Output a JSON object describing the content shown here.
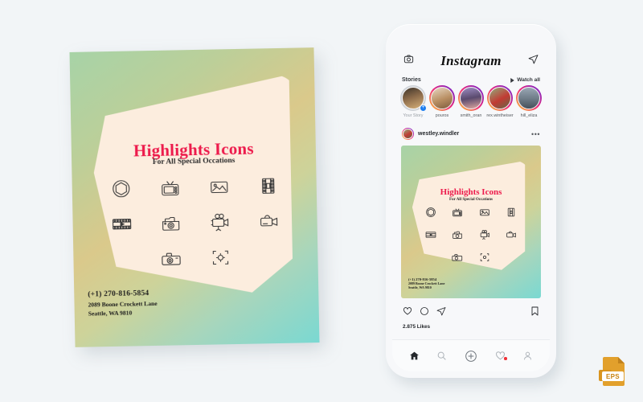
{
  "canvas": {
    "background": "#f2f5f7"
  },
  "poster": {
    "title": "Highlights Icons",
    "subtitle": "For All Special Occations",
    "title_color": "#ed1b4c",
    "cream_color": "#fcedde",
    "gradient": {
      "from": "#a7d3a7",
      "mid": "#dac98b",
      "to": "#7ad8d2"
    },
    "contact": {
      "phone": "(+1) 270-816-5854",
      "address_line1": "2089 Boone Crockett Lane",
      "address_line2": "Seattle, WA 9810"
    },
    "icons": [
      {
        "name": "aperture-icon"
      },
      {
        "name": "retro-tv-icon"
      },
      {
        "name": "photo-landscape-icon"
      },
      {
        "name": "film-strip-vertical-icon"
      },
      {
        "name": "film-strip-play-icon"
      },
      {
        "name": "vintage-camera-icon"
      },
      {
        "name": "movie-camera-icon"
      },
      {
        "name": "video-camera-icon"
      },
      {
        "name": "photo-camera-icon"
      },
      {
        "name": "focus-frame-icon"
      }
    ]
  },
  "phone": {
    "header": {
      "camera_icon": "camera-icon",
      "logo": "Instagram",
      "send_icon": "paper-plane-icon"
    },
    "stories": {
      "label": "Stories",
      "watch_all": "Watch all",
      "items": [
        {
          "name": "Your Story",
          "own": true,
          "seen": true
        },
        {
          "name": "pouros",
          "own": false,
          "seen": false
        },
        {
          "name": "smith_oran",
          "own": false,
          "seen": false
        },
        {
          "name": "rex.wintheiser",
          "own": false,
          "seen": false
        },
        {
          "name": "hill_eliza",
          "own": false,
          "seen": false
        }
      ]
    },
    "post": {
      "username": "westley.windler",
      "more_icon": "more-options-icon",
      "actions": {
        "like": "heart-icon",
        "comment": "comment-icon",
        "share": "paper-plane-icon",
        "save": "bookmark-icon"
      },
      "likes": "2.875 Likes"
    },
    "tabbar": [
      {
        "name": "tab-home",
        "icon": "home-icon",
        "active": true,
        "badge": false
      },
      {
        "name": "tab-search",
        "icon": "search-icon",
        "active": false,
        "badge": false
      },
      {
        "name": "tab-create",
        "icon": "plus-circle-icon",
        "active": false,
        "badge": false
      },
      {
        "name": "tab-activity",
        "icon": "heart-icon",
        "active": false,
        "badge": true
      },
      {
        "name": "tab-profile",
        "icon": "person-icon",
        "active": false,
        "badge": false
      }
    ]
  },
  "eps_badge": {
    "label": "EPS",
    "color": "#e2a02c"
  }
}
